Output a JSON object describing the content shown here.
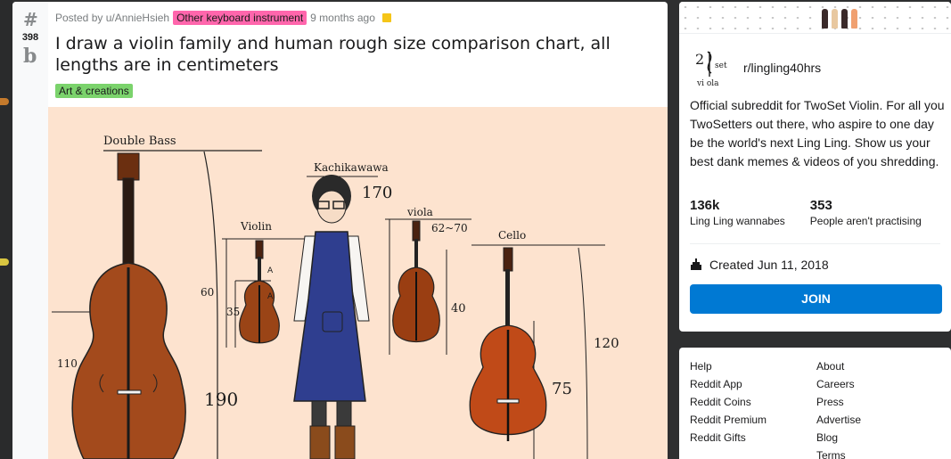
{
  "post": {
    "vote_up_icon": "#",
    "vote_count": "398",
    "vote_down_icon": "b",
    "posted_by": "Posted by u/AnnieHsieh",
    "flair": "Other keyboard instrument",
    "time": "9 months ago",
    "title": "I draw a violin family and human rough size comparison chart, all lengths are in centimeters",
    "tag": "Art & creations"
  },
  "image": {
    "double_bass_label": "Double Bass",
    "person_label": "Kachikawawa",
    "person_height": "170",
    "violin_label": "Violin",
    "viola_label": "viola",
    "viola_size": "62~70",
    "cello_label": "Cello",
    "dim_110": "110",
    "dim_190": "190",
    "dim_60": "60",
    "dim_35": "35",
    "dim_40": "40",
    "dim_120": "120",
    "dim_75": "75",
    "mark_a1": "A",
    "mark_a2": "A"
  },
  "sidebar": {
    "logo_text_1": "2",
    "logo_text_2": "set",
    "logo_text_3": "vi ola",
    "community": "r/lingling40hrs",
    "description": "Official subreddit for TwoSet Violin. For all you TwoSetters out there, who aspire to one day be the world's next Ling Ling. Show us your best dank memes & videos of you shredding.",
    "members": "136k",
    "members_label": "Ling Ling wannabes",
    "online": "353",
    "online_label": "People aren't practising",
    "created": "Created Jun 11, 2018",
    "join": "JOIN"
  },
  "footer_links": {
    "col1": [
      "Help",
      "Reddit App",
      "Reddit Coins",
      "Reddit Premium",
      "Reddit Gifts"
    ],
    "col2": [
      "About",
      "Careers",
      "Press",
      "Advertise",
      "Blog",
      "Terms"
    ]
  },
  "colors": {
    "flair_pink": "#ff66ac",
    "flair_green": "#7bd36c",
    "join_blue": "#0079d3",
    "image_bg": "#fde3cf"
  }
}
